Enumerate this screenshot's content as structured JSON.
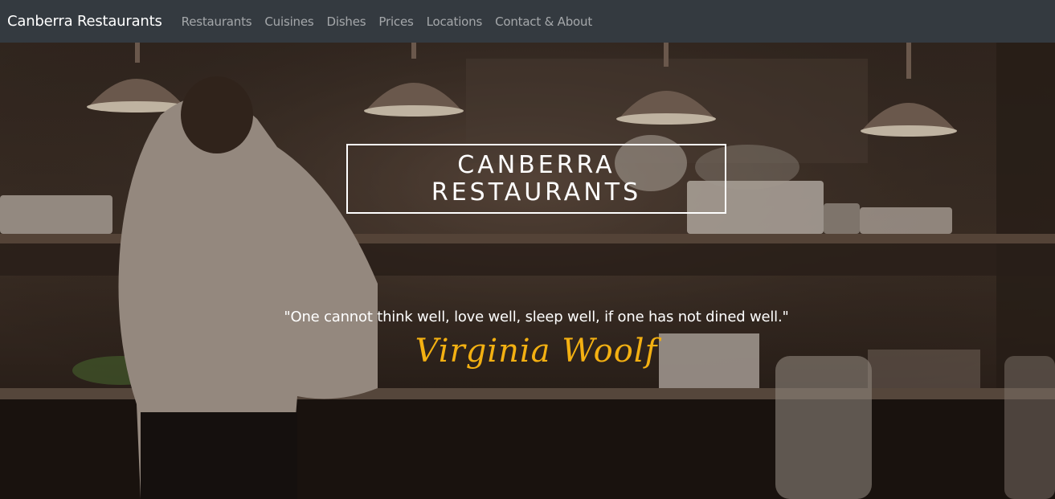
{
  "navbar": {
    "brand": "Canberra Restaurants",
    "links": [
      "Restaurants",
      "Cuisines",
      "Dishes",
      "Prices",
      "Locations",
      "Contact & About"
    ]
  },
  "hero": {
    "title_line1": "CANBERRA",
    "title_line2": "RESTAURANTS",
    "quote": "\"One cannot think well, love well, sleep well, if one has not dined well.\"",
    "author": "Virginia Woolf"
  },
  "colors": {
    "navbar_bg": "#343a40",
    "accent": "#f3b012",
    "nav_link": "rgba(255,255,255,0.55)"
  }
}
